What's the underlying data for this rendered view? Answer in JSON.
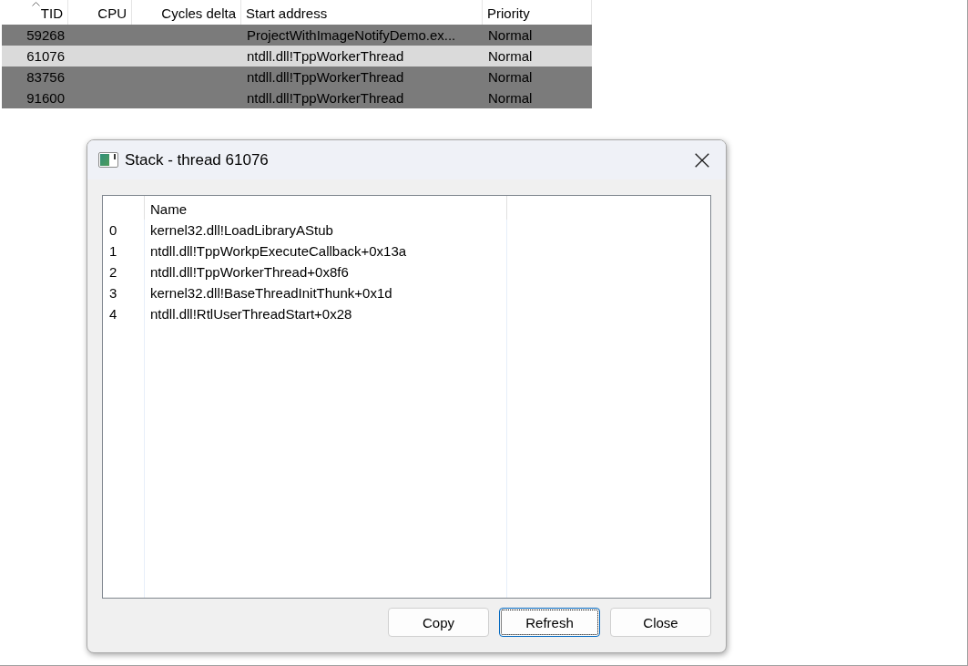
{
  "threads": {
    "columns": [
      {
        "label": "TID",
        "kind": "number",
        "sorted": true
      },
      {
        "label": "CPU",
        "kind": "number",
        "sorted": false
      },
      {
        "label": "Cycles delta",
        "kind": "number",
        "sorted": false
      },
      {
        "label": "Start address",
        "kind": "text",
        "sorted": false
      },
      {
        "label": "Priority",
        "kind": "text",
        "sorted": false
      }
    ],
    "rows": [
      {
        "tid": "59268",
        "start_address": "ProjectWithImageNotifyDemo.ex...",
        "priority": "Normal",
        "selected": false
      },
      {
        "tid": "61076",
        "start_address": "ntdll.dll!TppWorkerThread",
        "priority": "Normal",
        "selected": true
      },
      {
        "tid": "83756",
        "start_address": "ntdll.dll!TppWorkerThread",
        "priority": "Normal",
        "selected": false
      },
      {
        "tid": "91600",
        "start_address": "ntdll.dll!TppWorkerThread",
        "priority": "Normal",
        "selected": false
      }
    ]
  },
  "dialog": {
    "title": "Stack - thread 61076",
    "list": {
      "header": "Name",
      "frames": [
        {
          "index": "0",
          "name": "kernel32.dll!LoadLibraryAStub"
        },
        {
          "index": "1",
          "name": "ntdll.dll!TppWorkpExecuteCallback+0x13a"
        },
        {
          "index": "2",
          "name": "ntdll.dll!TppWorkerThread+0x8f6"
        },
        {
          "index": "3",
          "name": "kernel32.dll!BaseThreadInitThunk+0x1d"
        },
        {
          "index": "4",
          "name": "ntdll.dll!RtlUserThreadStart+0x28"
        }
      ]
    },
    "buttons": [
      {
        "label": "Copy",
        "focused": false
      },
      {
        "label": "Refresh",
        "focused": true
      },
      {
        "label": "Close",
        "focused": false
      }
    ]
  }
}
